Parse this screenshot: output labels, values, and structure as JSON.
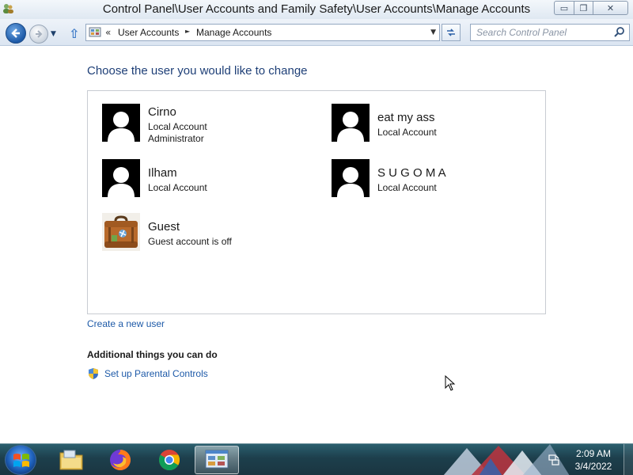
{
  "window": {
    "title": "Control Panel\\User Accounts and Family Safety\\User Accounts\\Manage Accounts",
    "minimize_symbol": "▭",
    "maximize_symbol": "❐",
    "close_symbol": "✕"
  },
  "addressbar": {
    "overflow_chevron": "«",
    "breadcrumb": [
      "User Accounts",
      "Manage Accounts"
    ],
    "separator": "►",
    "search_placeholder": "Search Control Panel"
  },
  "main": {
    "heading": "Choose the user you would like to change",
    "accounts": [
      {
        "name": "Cirno",
        "lines": [
          "Local Account",
          "Administrator"
        ],
        "picture": "default-user-silhouette"
      },
      {
        "name": "eat my ass",
        "lines": [
          "Local Account"
        ],
        "picture": "default-user-silhouette"
      },
      {
        "name": "Ilham",
        "lines": [
          "Local Account"
        ],
        "picture": "default-user-silhouette"
      },
      {
        "name": "S U G O M A",
        "lines": [
          "Local Account"
        ],
        "picture": "default-user-silhouette"
      },
      {
        "name": "Guest",
        "lines": [
          "Guest account is off"
        ],
        "picture": "suitcase"
      }
    ],
    "create_link": "Create a new user",
    "additional_heading": "Additional things you can do",
    "parental_link": "Set up Parental Controls"
  },
  "taskbar": {
    "pinned": [
      "start-orb",
      "explorer-icon",
      "firefox-icon",
      "chrome-icon",
      "control-panel-icon"
    ],
    "time": "2:09 AM",
    "date": "3/4/2022"
  },
  "colors": {
    "heading": "#1e3f77",
    "link": "#1e5aa8",
    "taskbar": "#1d3f4c"
  }
}
